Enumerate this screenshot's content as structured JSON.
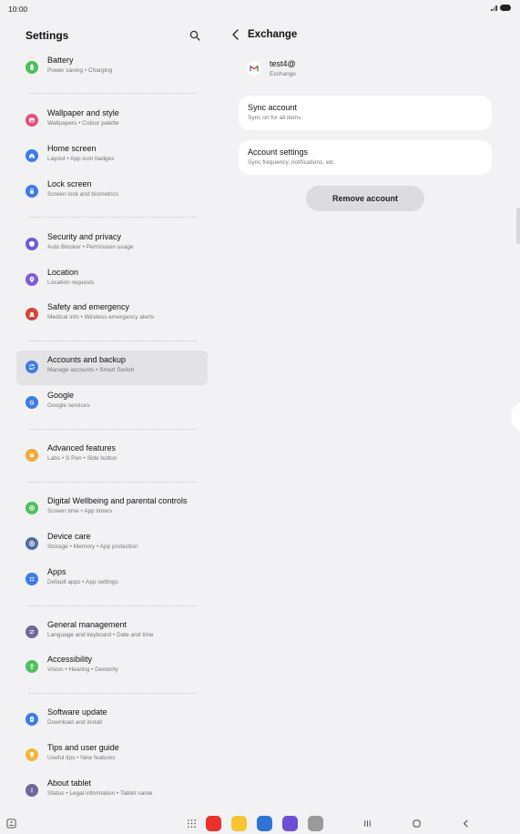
{
  "status_bar": {
    "time": "10:00"
  },
  "left_pane": {
    "title": "Settings",
    "items": [
      {
        "key": "battery",
        "title": "Battery",
        "subtitle": "Power saving • Charging",
        "icon": "battery-icon",
        "color": "#4fbf5a"
      },
      {
        "key": "wallpaper",
        "title": "Wallpaper and style",
        "subtitle": "Wallpapers • Colour palette",
        "icon": "palette-icon",
        "color": "#e1537a"
      },
      {
        "key": "home",
        "title": "Home screen",
        "subtitle": "Layout • App icon badges",
        "icon": "home-icon",
        "color": "#3d7de5"
      },
      {
        "key": "lock",
        "title": "Lock screen",
        "subtitle": "Screen lock and biometrics",
        "icon": "lock-icon",
        "color": "#3d7de5"
      },
      {
        "key": "security",
        "title": "Security and privacy",
        "subtitle": "Auto Blocker • Permission usage",
        "icon": "shield-icon",
        "color": "#6e5cd6"
      },
      {
        "key": "location",
        "title": "Location",
        "subtitle": "Location requests",
        "icon": "location-pin-icon",
        "color": "#7a5fdd"
      },
      {
        "key": "safety",
        "title": "Safety and emergency",
        "subtitle": "Medical info • Wireless emergency alerts",
        "icon": "emergency-bell-icon",
        "color": "#d9453b"
      },
      {
        "key": "accounts",
        "title": "Accounts and backup",
        "subtitle": "Manage accounts • Smart Switch",
        "icon": "sync-icon",
        "color": "#3d7de5",
        "active": true
      },
      {
        "key": "google",
        "title": "Google",
        "subtitle": "Google services",
        "icon": "google-g-icon",
        "color": "#3d7de5"
      },
      {
        "key": "advanced",
        "title": "Advanced features",
        "subtitle": "Labs • S Pen • Side button",
        "icon": "gear-plus-icon",
        "color": "#f2a93b"
      },
      {
        "key": "wellbeing",
        "title": "Digital Wellbeing and parental controls",
        "subtitle": "Screen time • App timers",
        "icon": "heart-circle-icon",
        "color": "#4fbf5a"
      },
      {
        "key": "devicecare",
        "title": "Device care",
        "subtitle": "Storage • Memory • App protection",
        "icon": "device-care-icon",
        "color": "#5a6aa8"
      },
      {
        "key": "apps",
        "title": "Apps",
        "subtitle": "Default apps • App settings",
        "icon": "apps-grid-icon",
        "color": "#3d7de5"
      },
      {
        "key": "general",
        "title": "General management",
        "subtitle": "Language and keyboard • Date and time",
        "icon": "sliders-icon",
        "color": "#6a6a9e"
      },
      {
        "key": "accessibility",
        "title": "Accessibility",
        "subtitle": "Vision • Hearing • Dexterity",
        "icon": "person-icon",
        "color": "#4fbf5a"
      },
      {
        "key": "software",
        "title": "Software update",
        "subtitle": "Download and install",
        "icon": "update-icon",
        "color": "#3d7de5"
      },
      {
        "key": "tips",
        "title": "Tips and user guide",
        "subtitle": "Useful tips • New features",
        "icon": "lightbulb-icon",
        "color": "#f2b53b"
      },
      {
        "key": "about",
        "title": "About tablet",
        "subtitle": "Status • Legal information • Tablet name",
        "icon": "info-icon",
        "color": "#6a6a9e"
      }
    ]
  },
  "right_pane": {
    "title": "Exchange",
    "account": {
      "email": "test4@",
      "type": "Exchange"
    },
    "sync_account": {
      "title": "Sync account",
      "subtitle": "Sync on for all items"
    },
    "account_settings": {
      "title": "Account settings",
      "subtitle": "Sync frequency, notifications, etc."
    },
    "remove_label": "Remove account"
  },
  "navbar": {
    "apps": [
      {
        "name": "app-drawer",
        "color": "#555555"
      },
      {
        "name": "notes-app",
        "color": "#e8322c"
      },
      {
        "name": "files-app",
        "color": "#f6c431"
      },
      {
        "name": "messages-app",
        "color": "#2f73d8"
      },
      {
        "name": "internet-app",
        "color": "#6c4fd6"
      },
      {
        "name": "camera-app",
        "color": "#9a9a9a"
      }
    ]
  }
}
